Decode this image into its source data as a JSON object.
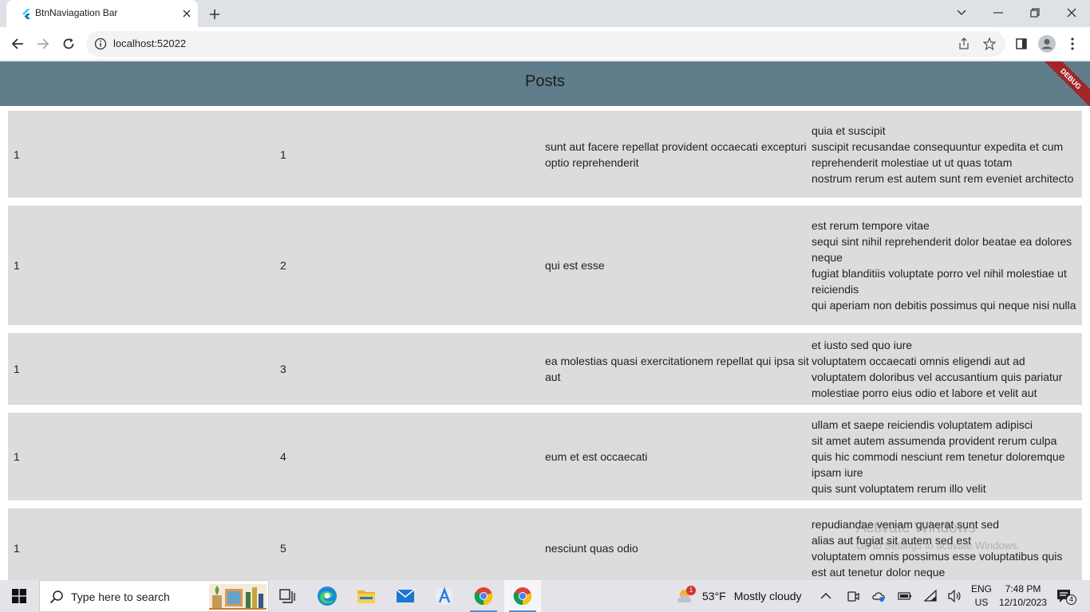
{
  "browser": {
    "tab_title": "BtnNaviagation Bar",
    "url": "localhost:52022"
  },
  "app": {
    "title": "Posts",
    "debug_banner": "DEBUG",
    "posts": [
      {
        "userId": "1",
        "id": "1",
        "title": "sunt aut facere repellat provident occaecati excepturi optio reprehenderit",
        "body": "quia et suscipit\nsuscipit recusandae consequuntur expedita et cum reprehenderit molestiae ut ut quas totam\nnostrum rerum est autem sunt rem eveniet architecto"
      },
      {
        "userId": "1",
        "id": "2",
        "title": "qui est esse",
        "body": "est rerum tempore vitae\nsequi sint nihil reprehenderit dolor beatae ea dolores neque\nfugiat blanditiis voluptate porro vel nihil molestiae ut reiciendis\nqui aperiam non debitis possimus qui neque nisi nulla"
      },
      {
        "userId": "1",
        "id": "3",
        "title": "ea molestias quasi exercitationem repellat qui ipsa sit aut",
        "body": "et iusto sed quo iure\nvoluptatem occaecati omnis eligendi aut ad\nvoluptatem doloribus vel accusantium quis pariatur\nmolestiae porro eius odio et labore et velit aut"
      },
      {
        "userId": "1",
        "id": "4",
        "title": "eum et est occaecati",
        "body": "ullam et saepe reiciendis voluptatem adipisci\nsit amet autem assumenda provident rerum culpa\nquis hic commodi nesciunt rem tenetur doloremque ipsam iure\nquis sunt voluptatem rerum illo velit"
      },
      {
        "userId": "1",
        "id": "5",
        "title": "nesciunt quas odio",
        "body": "repudiandae veniam quaerat sunt sed\nalias aut fugiat sit autem sed est\nvoluptatem omnis possimus esse voluptatibus quis\nest aut tenetur dolor neque"
      }
    ]
  },
  "watermark": {
    "line1": "Activate Windows",
    "line2": "Go to Settings to activate Windows."
  },
  "taskbar": {
    "search_placeholder": "Type here to search",
    "weather_temp": "53°F",
    "weather_text": "Mostly cloudy",
    "weather_badge": "1",
    "lang_line1": "ENG",
    "lang_line2": "US",
    "time": "7:48 PM",
    "date": "12/10/2023",
    "notification_count": "4"
  },
  "colors": {
    "appbar": "#607d8b",
    "card": "#dcdcdc",
    "debug": "#a0262a"
  }
}
